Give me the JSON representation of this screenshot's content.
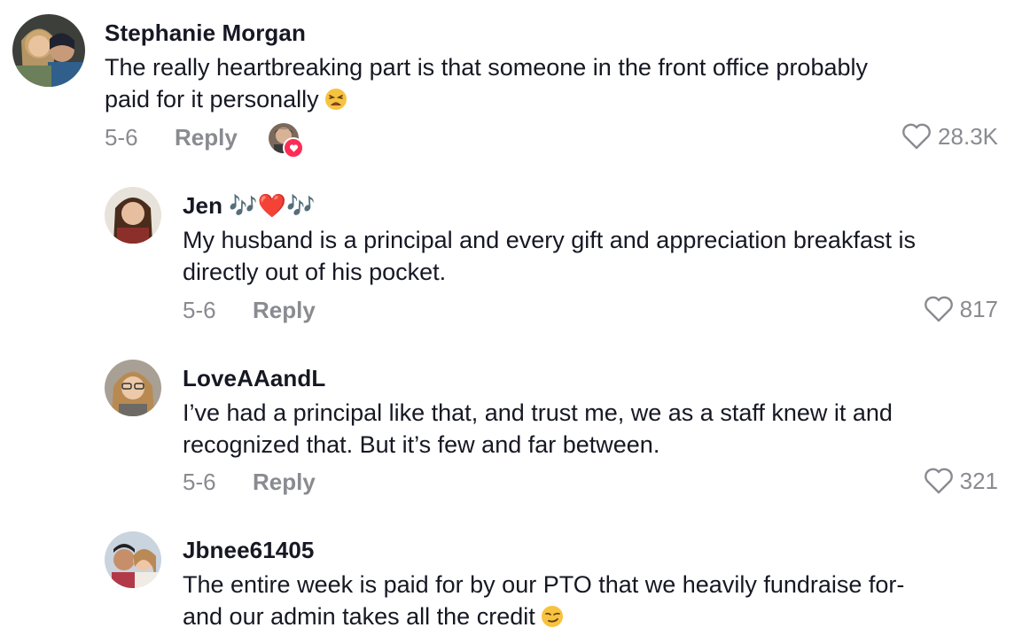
{
  "comments": [
    {
      "username": "Stephanie Morgan",
      "text": "The really heartbreaking part is that someone in the front office probably\npaid for it personally",
      "emoji_icon": "weary-face-icon",
      "date": "5-6",
      "reply_label": "Reply",
      "likes": "28.3K",
      "creator_liked": true
    },
    {
      "username": "Jen 🎶❤️🎶",
      "text": "My husband is a principal and every gift and appreciation breakfast is\ndirectly out of his pocket.",
      "date": "5-6",
      "reply_label": "Reply",
      "likes": "817"
    },
    {
      "username": "LoveAAandL",
      "text": "I’ve had a principal like that, and trust me, we as a staff knew it and\nrecognized that. But it’s few and far between.",
      "date": "5-6",
      "reply_label": "Reply",
      "likes": "321"
    },
    {
      "username": "Jbnee61405",
      "text": "The entire week is paid for by our PTO that we heavily fundraise for-\nand our admin takes all the credit",
      "emoji_icon": "smirking-face-icon"
    }
  ],
  "colors": {
    "text": "#161823",
    "muted": "#8a8b91",
    "like_badge": "#fe2c55"
  }
}
